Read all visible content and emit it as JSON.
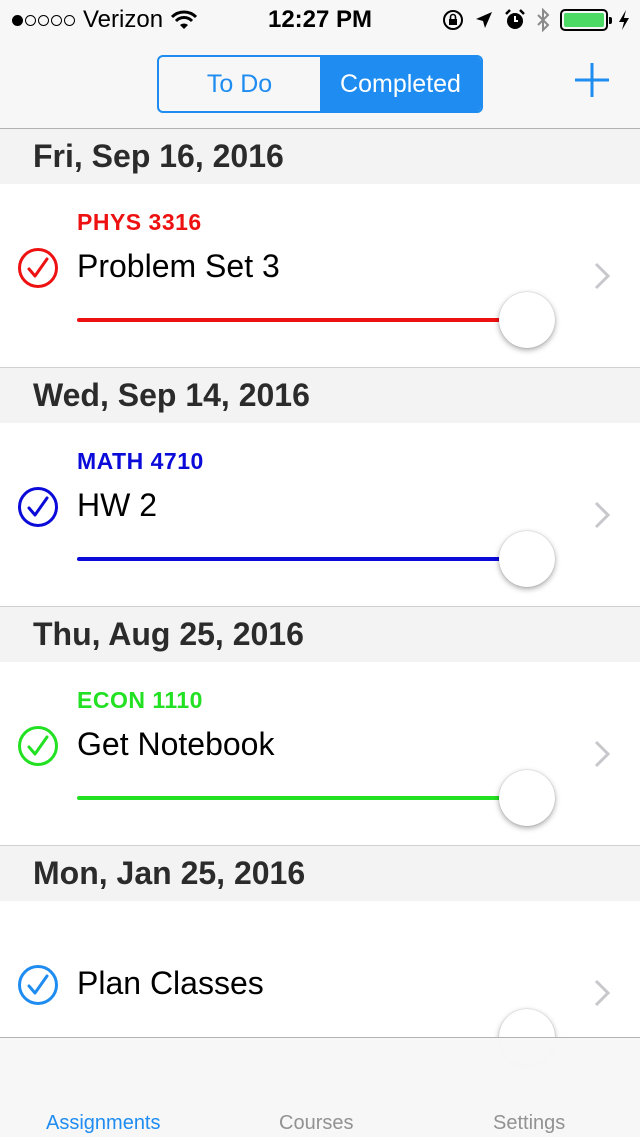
{
  "status_bar": {
    "carrier": "Verizon",
    "time": "12:27 PM",
    "signal_bars_filled": 1,
    "signal_bars_total": 5,
    "battery_level": 1.0,
    "icons": [
      "wifi-icon",
      "orientation-lock-icon",
      "location-arrow-icon",
      "alarm-icon",
      "bluetooth-icon",
      "battery-icon",
      "charging-bolt-icon"
    ]
  },
  "nav": {
    "segments": [
      "To Do",
      "Completed"
    ],
    "selected_segment": "Completed",
    "add_icon": "plus-icon",
    "accent_color": "#1e8cf0"
  },
  "sections": [
    {
      "date": "Fri, Sep 16, 2016",
      "items": [
        {
          "course": "PHYS 3316",
          "title": "Problem Set 3",
          "color": "#ee1111",
          "progress": 1.0
        }
      ]
    },
    {
      "date": "Wed, Sep 14, 2016",
      "items": [
        {
          "course": "MATH 4710",
          "title": "HW 2",
          "color": "#0a0ad9",
          "progress": 1.0
        }
      ]
    },
    {
      "date": "Thu, Aug 25, 2016",
      "items": [
        {
          "course": "ECON 1110",
          "title": "Get Notebook",
          "color": "#22e022",
          "progress": 1.0
        }
      ]
    },
    {
      "date": "Mon, Jan 25, 2016",
      "items": [
        {
          "course": "",
          "title": "Plan Classes",
          "color": "#1e8cf0",
          "progress": 1.0
        }
      ]
    }
  ],
  "tab_bar": {
    "tabs": [
      "Assignments",
      "Courses",
      "Settings"
    ],
    "selected_tab": "Assignments"
  }
}
